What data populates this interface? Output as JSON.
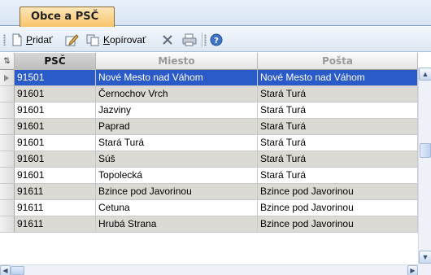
{
  "tab": {
    "label": "Obce a PSČ"
  },
  "toolbar": {
    "add_label": "Pridať",
    "add_accel": "P",
    "add_rest": "ridať",
    "copy_accel": "K",
    "copy_rest": "opírovať",
    "icons": [
      "new-document-icon",
      "edit-icon",
      "copy-icon",
      "delete-icon",
      "print-icon",
      "help-icon"
    ]
  },
  "grid": {
    "corner_glyph": "⇅",
    "columns": [
      {
        "key": "psc",
        "label": "PSČ"
      },
      {
        "key": "miesto",
        "label": "Miesto"
      },
      {
        "key": "posta",
        "label": "Pošta"
      }
    ],
    "rows": [
      {
        "psc": "91501",
        "miesto": "Nové Mesto nad Váhom",
        "posta": "Nové Mesto nad Váhom"
      },
      {
        "psc": "91601",
        "miesto": "Černochov Vrch",
        "posta": "Stará Turá"
      },
      {
        "psc": "91601",
        "miesto": "Jazviny",
        "posta": "Stará Turá"
      },
      {
        "psc": "91601",
        "miesto": "Paprad",
        "posta": "Stará Turá"
      },
      {
        "psc": "91601",
        "miesto": "Stará Turá",
        "posta": "Stará Turá"
      },
      {
        "psc": "91601",
        "miesto": "Súš",
        "posta": "Stará Turá"
      },
      {
        "psc": "91601",
        "miesto": "Topolecká",
        "posta": "Stará Turá"
      },
      {
        "psc": "91611",
        "miesto": "Bzince pod Javorinou",
        "posta": "Bzince pod Javorinou"
      },
      {
        "psc": "91611",
        "miesto": "Cetuna",
        "posta": "Bzince pod Javorinou"
      },
      {
        "psc": "91611",
        "miesto": "Hrubá Strana",
        "posta": "Bzince pod Javorinou"
      }
    ],
    "selected_row": 0
  },
  "colors": {
    "selection": "#2a5bc8",
    "alt_row": "#dcdad4",
    "tab_active": "#f9c46b"
  }
}
